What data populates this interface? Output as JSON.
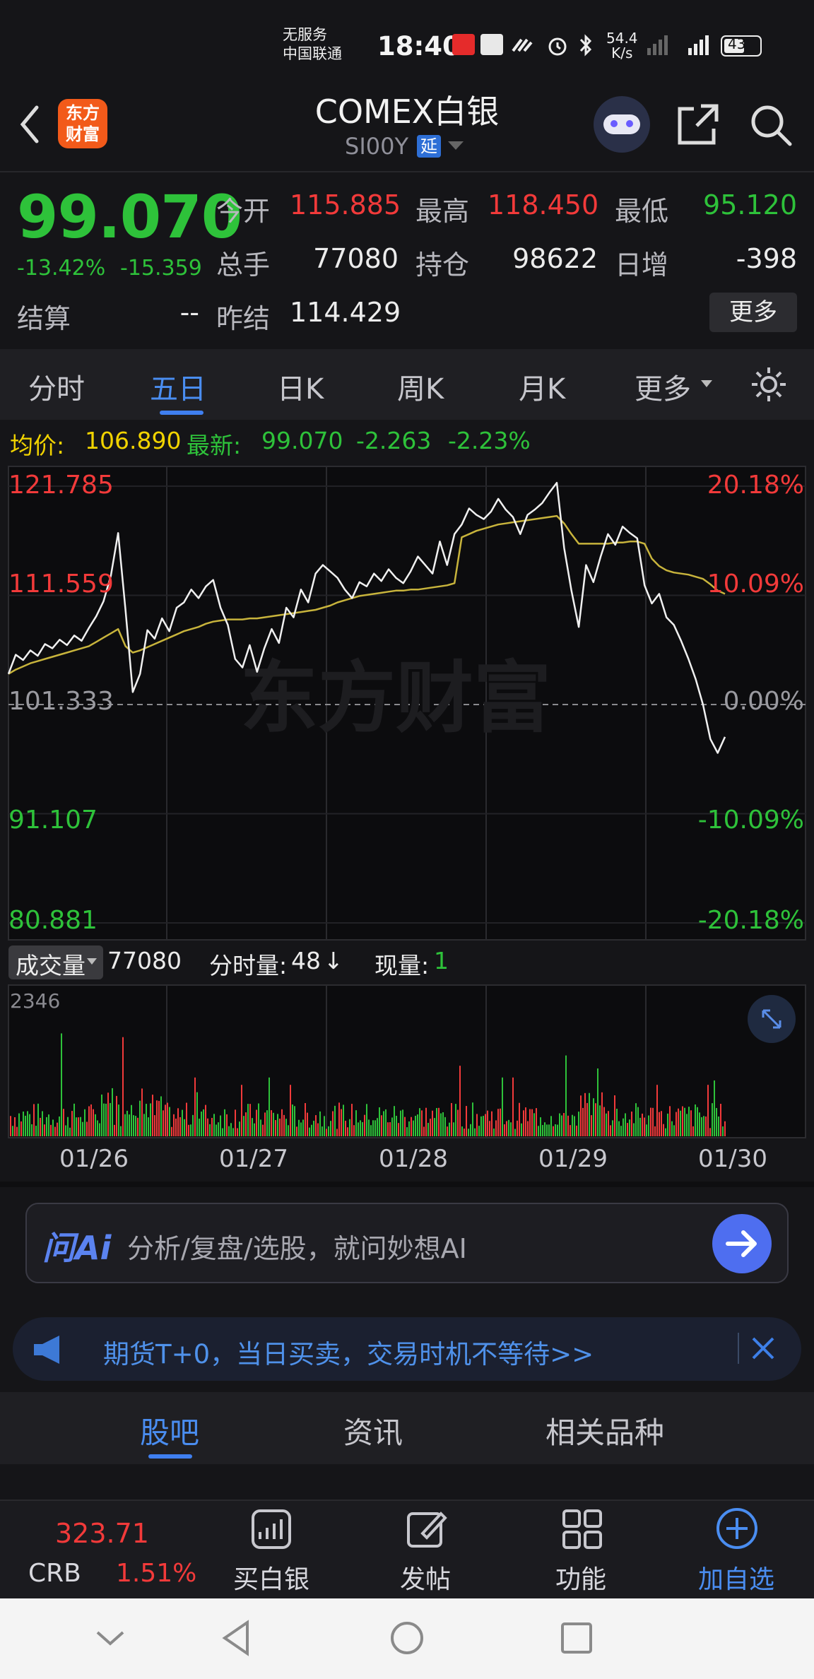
{
  "status_bar": {
    "carrier_line1": "无服务",
    "carrier_line2": "中国联通",
    "time": "18:40",
    "net_speed_value": "54.4",
    "net_speed_unit": "K/s",
    "battery": "43"
  },
  "header": {
    "title": "COMEX白银",
    "code": "SI00Y",
    "delay_badge": "延",
    "logo_line1": "东方",
    "logo_line2": "财富"
  },
  "quote": {
    "price": "99.070",
    "change_pct": "-13.42%",
    "change_abs": "-15.359",
    "open_label": "今开",
    "open": "115.885",
    "high_label": "最高",
    "high": "118.450",
    "low_label": "最低",
    "low": "95.120",
    "volume_label": "总手",
    "volume": "77080",
    "oi_label": "持仓",
    "oi": "98622",
    "daily_inc_label": "日增",
    "daily_inc": "-398",
    "settle_label": "结算",
    "settle": "--",
    "prev_settle_label": "昨结",
    "prev_settle": "114.429",
    "more_button": "更多"
  },
  "tabs": [
    "分时",
    "五日",
    "日K",
    "周K",
    "月K",
    "更多"
  ],
  "info_line": {
    "avg_label": "均价:",
    "avg_value": "106.890",
    "latest_label": "最新:",
    "latest_value": "99.070",
    "change_abs": "-2.263",
    "change_pct": "-2.23%"
  },
  "chart_data": {
    "type": "line",
    "watermark": "东方财富",
    "x_dates": [
      "01/26",
      "01/27",
      "01/28",
      "01/29",
      "01/30"
    ],
    "y_labels_left": [
      "121.785",
      "111.559",
      "101.333",
      "91.107",
      "80.881"
    ],
    "y_labels_right": [
      "20.18%",
      "10.09%",
      "0.00%",
      "-10.09%",
      "-20.18%"
    ],
    "ylim": [
      80.881,
      121.785
    ],
    "baseline": 101.333,
    "series": [
      {
        "values": [
          104.2,
          106.0,
          105.5,
          106.4,
          105.9,
          107.0,
          106.6,
          107.4,
          106.9,
          107.8,
          107.3,
          108.5,
          109.6,
          111.0,
          113.4,
          117.4,
          110.2,
          102.5,
          104.2,
          108.3,
          107.5,
          109.4,
          108.2,
          110.4,
          110.9,
          112.1,
          111.3,
          112.4,
          113.0,
          110.4,
          108.8,
          105.6,
          104.8,
          106.9,
          104.4,
          106.6,
          108.4,
          107.1,
          110.4,
          109.5,
          112.1,
          110.9,
          113.6,
          114.4,
          113.8,
          113.2,
          112.1,
          111.3,
          112.8,
          112.4,
          113.6,
          112.9,
          114.0,
          113.2,
          112.7,
          113.8,
          115.2,
          114.4,
          113.6,
          116.6,
          114.4,
          117.3,
          118.2,
          119.7,
          119.1,
          118.7,
          119.4,
          120.6,
          119.6,
          118.9,
          117.3,
          119.1,
          119.6,
          120.2,
          121.2,
          122.1,
          116.0,
          112.0,
          108.6,
          114.4,
          112.8,
          115.2,
          117.3,
          116.3,
          118.0,
          117.4,
          116.9,
          112.5,
          110.8,
          111.7,
          109.5,
          108.8,
          107.3,
          105.6,
          103.7,
          101.3,
          98.1,
          96.8,
          98.3
        ],
        "avg": [
          104.2,
          104.6,
          104.9,
          105.2,
          105.4,
          105.6,
          105.8,
          106.0,
          106.2,
          106.4,
          106.6,
          106.8,
          107.2,
          107.6,
          108.0,
          108.4,
          106.8,
          106.2,
          106.4,
          106.7,
          107.0,
          107.3,
          107.6,
          107.9,
          108.2,
          108.4,
          108.6,
          108.9,
          109.1,
          109.2,
          109.3,
          109.3,
          109.3,
          109.4,
          109.4,
          109.5,
          109.6,
          109.7,
          109.8,
          109.9,
          110.0,
          110.1,
          110.2,
          110.4,
          110.6,
          110.9,
          111.1,
          111.3,
          111.5,
          111.6,
          111.7,
          111.8,
          111.9,
          112.0,
          112.0,
          112.1,
          112.1,
          112.2,
          112.3,
          112.4,
          112.5,
          112.7,
          117.0,
          117.3,
          117.6,
          117.8,
          118.0,
          118.2,
          118.3,
          118.4,
          118.5,
          118.6,
          118.7,
          118.8,
          118.9,
          119.0,
          118.3,
          117.3,
          116.4,
          116.4,
          116.4,
          116.4,
          116.4,
          116.5,
          116.5,
          116.6,
          116.6,
          116.4,
          115.0,
          114.3,
          113.9,
          113.7,
          113.6,
          113.5,
          113.3,
          113.1,
          112.6,
          112.0,
          111.7
        ]
      }
    ]
  },
  "volume": {
    "dropdown_label": "成交量",
    "total": "77080",
    "tick_label": "分时量:",
    "tick_value": "48",
    "tick_arrow": "↓",
    "current_label": "现量:",
    "current_value": "1",
    "max_label": "2346"
  },
  "ai_box": {
    "logo": "问Ai",
    "placeholder": "分析/复盘/选股，就问妙想AI"
  },
  "banner": {
    "text": "期货T+0，当日买卖，交易时机不等待>>"
  },
  "lower_tabs": [
    "股吧",
    "资讯",
    "相关品种"
  ],
  "bottom_bar": {
    "index_value": "323.71",
    "index_name": "CRB",
    "index_pct": "1.51%",
    "buy_label": "买白银",
    "post_label": "发帖",
    "func_label": "功能",
    "add_label": "加自选"
  },
  "colors": {
    "up": "#f23a3a",
    "down": "#2ec23a",
    "accent": "#4a8df0",
    "avg_line": "#c8b43c"
  }
}
